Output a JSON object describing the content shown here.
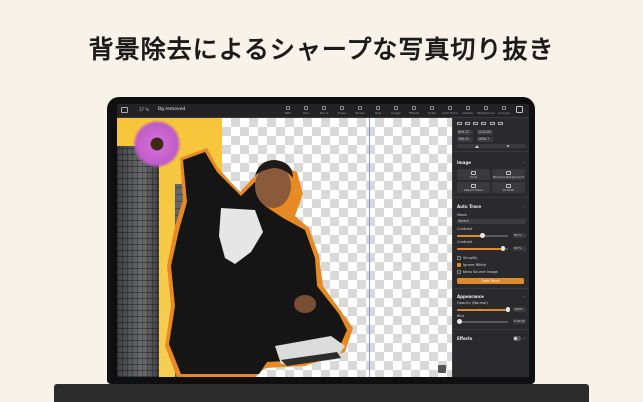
{
  "headline": "背景除去によるシャープな写真切り抜き",
  "toolbar": {
    "zoom": "37 %",
    "zoom_sub": "Zoom",
    "title": "Bg removed",
    "tools": [
      "Path",
      "Pen",
      "Pencil",
      "Erase",
      "Shape",
      "Text",
      "Image",
      "Effects",
      "Scale",
      "Auto Trace",
      "Rotate",
      "Bg Remove",
      "Arrange"
    ],
    "export_label": "Export"
  },
  "inspector": {
    "x_value": "808.22",
    "w_value": "1242.83",
    "y_value": "398.51",
    "h_value": "1658.7",
    "image_title": "Image",
    "crop_label": "Crop",
    "remove_bg_label": "Remove Background",
    "object_trace_label": "Object Trace",
    "ai_grab_label": "AI Grab",
    "auto_trace_title": "Auto Trace",
    "mode_label": "Mode",
    "mode_value": "Sketch",
    "contrast_label": "Contrast",
    "contrast_value": "50 %",
    "contrast_fraction": 0.5,
    "contrast2_label": "Contrast",
    "contrast2_value": "90 %",
    "contrast2_fraction": 0.9,
    "simplify_label": "Simplify",
    "ignore_white_label": "Ignore White",
    "keep_source_label": "Keep Source Image",
    "auto_trace_button": "Auto Trace",
    "appearance_title": "Appearance",
    "opacity_label": "Opacity (Normal)",
    "opacity_value": "100%",
    "opacity_fraction": 1.0,
    "blur_label": "Blur",
    "blur_value": "0.00 pt",
    "blur_fraction": 0.0,
    "effects_title": "Effects"
  },
  "colors": {
    "accent": "#e08a2c",
    "background": "#f8f2e8",
    "canvas_left": "#f5c83f",
    "flower": "#c85ed0"
  }
}
